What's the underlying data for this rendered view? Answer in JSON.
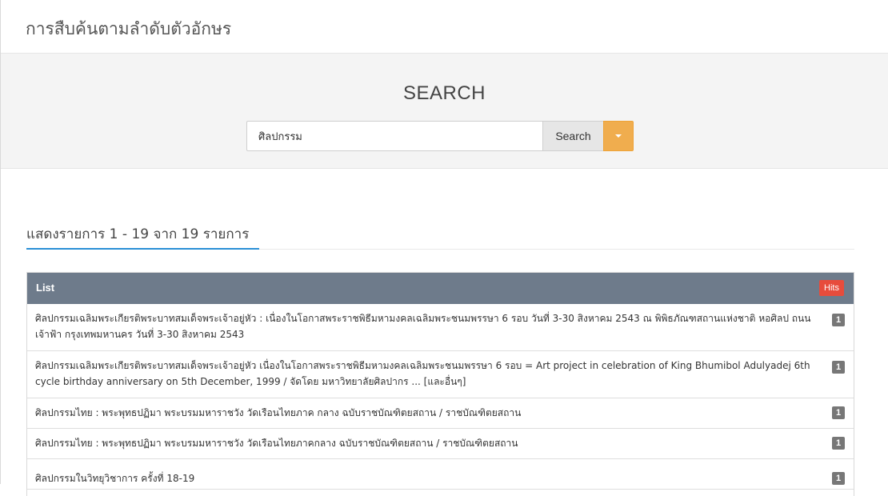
{
  "header": {
    "title": "การสืบค้นตามลำดับตัวอักษร"
  },
  "search": {
    "heading": "SEARCH",
    "query": "ศิลปกรรม",
    "button_label": "Search",
    "dropdown_icon": "caret-down-icon",
    "accent_color": "#f0ad4e"
  },
  "results": {
    "summary": "แสดงรายการ 1 - 19 จาก 19 รายการ",
    "list_label": "List",
    "hits_label": "Hits",
    "items": [
      {
        "text": "ศิลปกรรมเฉลิมพระเกียรติพระบาทสมเด็จพระเจ้าอยู่หัว : เนื่องในโอกาสพระราชพิธีมหามงคลเฉลิมพระชนมพรรษา 6 รอบ วันที่ 3-30 สิงหาคม 2543 ณ พิพิธภัณฑสถานแห่งชาติ หอศิลป ถนนเจ้าฟ้า กรุงเทพมหานคร วันที่ 3-30 สิงหาคม 2543",
        "hits": "1"
      },
      {
        "text": "ศิลปกรรมเฉลิมพระเกียรติพระบาทสมเด็จพระเจ้าอยู่หัว เนื่องในโอกาสพระราชพิธีมหามงคลเฉลิมพระชนมพรรษา 6 รอบ = Art project in celebration of King Bhumibol Adulyadej 6th cycle birthday anniversary on 5th December, 1999 / จัดโดย มหาวิทยาลัยศิลปากร ... [และอื่นๆ]",
        "hits": "1"
      },
      {
        "text": "ศิลปกรรมไทย : พระพุทธปฏิมา พระบรมมหาราชวัง วัดเรือนไทยภาค กลาง ฉบับราชบัณฑิตยสถาน / ราชบัณฑิตยสถาน",
        "hits": "1"
      },
      {
        "text": "ศิลปกรรมไทย : พระพุทธปฏิมา พระบรมมหาราชวัง วัดเรือนไทยภาคกลาง ฉบับราชบัณฑิตยสถาน / ราชบัณฑิตยสถาน",
        "hits": "1"
      },
      {
        "text": "ศิลปกรรมในวิทยุวิชาการ ครั้งที่ 18-19",
        "hits": "1"
      }
    ]
  }
}
